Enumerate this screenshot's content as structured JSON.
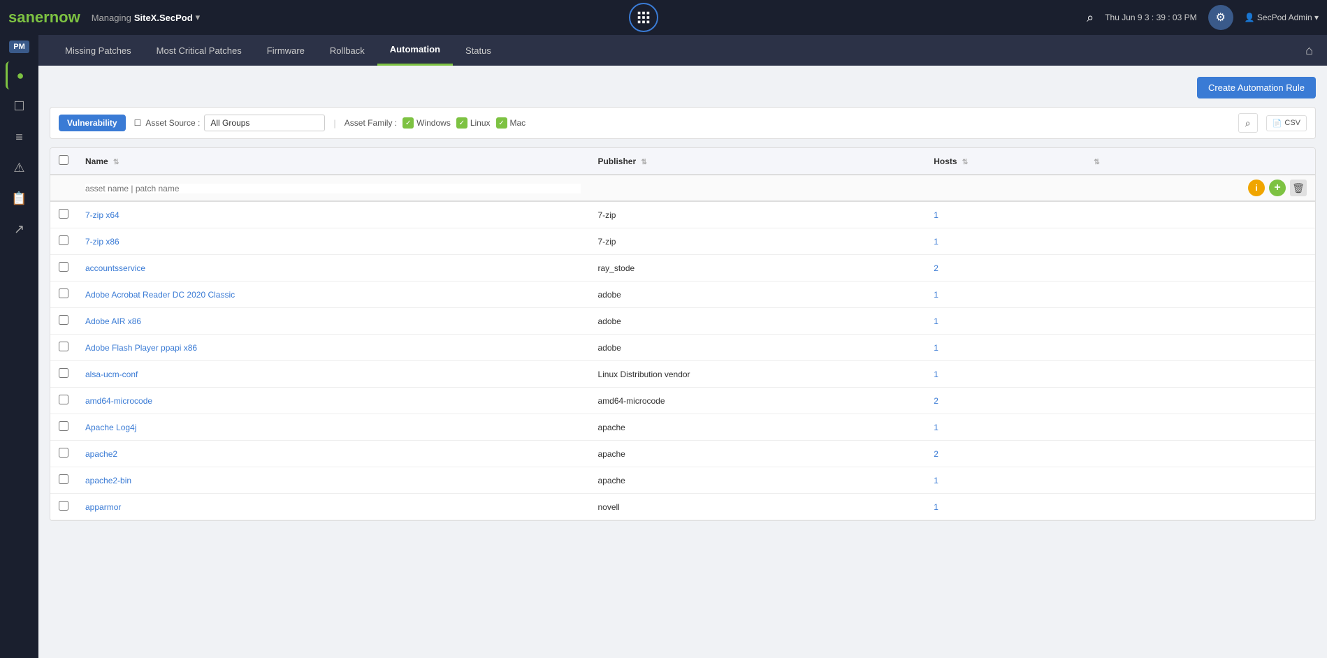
{
  "topbar": {
    "logo_saner": "saner",
    "logo_now": "now",
    "managing_label": "Managing",
    "site_name": "SiteX.SecPod",
    "datetime": "Thu Jun 9  3 : 39 : 03 PM",
    "user": "SecPod Admin"
  },
  "navbar": {
    "items": [
      {
        "id": "missing-patches",
        "label": "Missing Patches",
        "active": false
      },
      {
        "id": "most-critical-patches",
        "label": "Most Critical Patches",
        "active": false
      },
      {
        "id": "firmware",
        "label": "Firmware",
        "active": false
      },
      {
        "id": "rollback",
        "label": "Rollback",
        "active": false
      },
      {
        "id": "automation",
        "label": "Automation",
        "active": true
      },
      {
        "id": "status",
        "label": "Status",
        "active": false
      }
    ]
  },
  "sidebar": {
    "pm_label": "PM",
    "icons": [
      {
        "id": "eye",
        "symbol": "👁",
        "active": true
      },
      {
        "id": "desktop",
        "symbol": "🖥",
        "active": false
      },
      {
        "id": "list",
        "symbol": "☰",
        "active": false
      },
      {
        "id": "warning",
        "symbol": "⚠",
        "active": false
      },
      {
        "id": "report",
        "symbol": "📋",
        "active": false
      },
      {
        "id": "export",
        "symbol": "↗",
        "active": false
      }
    ]
  },
  "main": {
    "create_btn": "Create Automation Rule",
    "filter": {
      "vulnerability_label": "Vulnerability",
      "asset_source_label": "Asset Source :",
      "asset_source_value": "All Groups",
      "asset_family_label": "Asset Family :",
      "checkboxes": [
        {
          "id": "windows",
          "label": "Windows",
          "checked": true
        },
        {
          "id": "linux",
          "label": "Linux",
          "checked": true
        },
        {
          "id": "mac",
          "label": "Mac",
          "checked": true
        }
      ],
      "csv_label": "CSV"
    },
    "table": {
      "columns": [
        {
          "id": "name",
          "label": "Name"
        },
        {
          "id": "publisher",
          "label": "Publisher"
        },
        {
          "id": "hosts",
          "label": "Hosts"
        }
      ],
      "search_placeholder_name": "asset name | patch name",
      "rows": [
        {
          "name": "7-zip x64",
          "publisher": "7-zip",
          "hosts": "1"
        },
        {
          "name": "7-zip x86",
          "publisher": "7-zip",
          "hosts": "1"
        },
        {
          "name": "accountsservice",
          "publisher": "ray_stode",
          "hosts": "2"
        },
        {
          "name": "Adobe Acrobat Reader DC 2020 Classic",
          "publisher": "adobe",
          "hosts": "1"
        },
        {
          "name": "Adobe AIR x86",
          "publisher": "adobe",
          "hosts": "1"
        },
        {
          "name": "Adobe Flash Player ppapi x86",
          "publisher": "adobe",
          "hosts": "1"
        },
        {
          "name": "alsa-ucm-conf",
          "publisher": "Linux Distribution vendor",
          "hosts": "1"
        },
        {
          "name": "amd64-microcode",
          "publisher": "amd64-microcode",
          "hosts": "2"
        },
        {
          "name": "Apache Log4j",
          "publisher": "apache",
          "hosts": "1"
        },
        {
          "name": "apache2",
          "publisher": "apache",
          "hosts": "2"
        },
        {
          "name": "apache2-bin",
          "publisher": "apache",
          "hosts": "1"
        },
        {
          "name": "apparmor",
          "publisher": "novell",
          "hosts": "1"
        }
      ]
    }
  }
}
